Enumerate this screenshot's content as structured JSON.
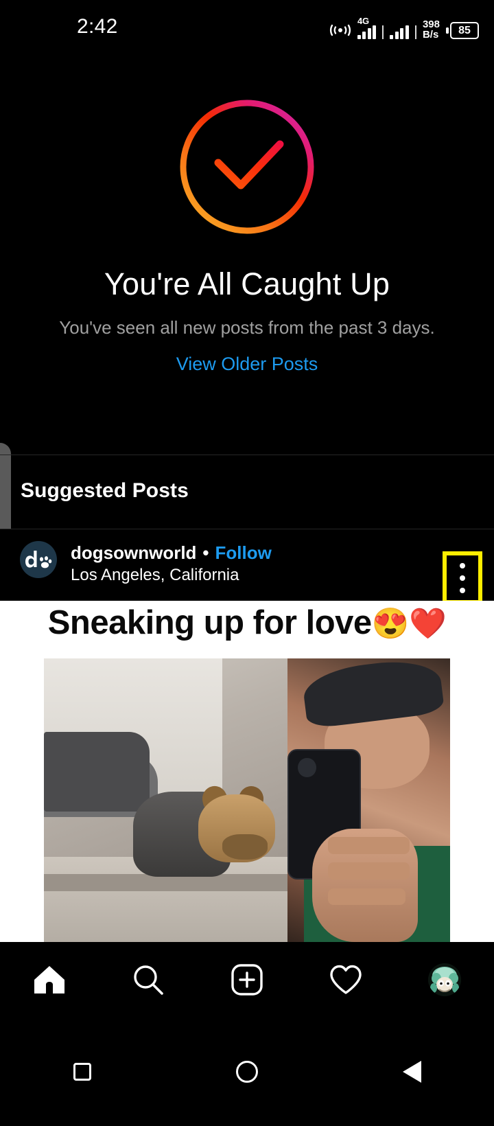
{
  "status_bar": {
    "time": "2:42",
    "network_type": "4G",
    "data_rate_value": "398",
    "data_rate_unit": "B/s",
    "battery_percent": "85",
    "icons": [
      "cast-icon",
      "signal-sim1-icon",
      "signal-sim2-icon",
      "battery-icon"
    ]
  },
  "caught_up": {
    "icon": "check-circle-icon",
    "title": "You're All Caught Up",
    "subtitle": "You've seen all new posts from the past 3 days.",
    "link_label": "View Older Posts",
    "link_color": "#1d9bf0",
    "gradient_start": "#f9a825",
    "gradient_mid": "#f42b03",
    "gradient_end": "#d6249f"
  },
  "suggested": {
    "section_title": "Suggested Posts"
  },
  "post": {
    "avatar_initial": "d",
    "avatar_icon": "paw-print-icon",
    "avatar_bg": "#1e3749",
    "username": "dogsownworld",
    "separator": "•",
    "follow_label": "Follow",
    "follow_color": "#1d9bf0",
    "location": "Los Angeles, California",
    "menu_icon": "more-options-icon",
    "menu_highlight_color": "#ffee00",
    "caption": "Sneaking up for love",
    "caption_emojis": "😍❤️",
    "media_type": "video"
  },
  "bottom_nav": {
    "items": [
      {
        "name": "home",
        "icon": "home-icon",
        "active": true
      },
      {
        "name": "search",
        "icon": "search-icon",
        "active": false
      },
      {
        "name": "create",
        "icon": "plus-square-icon",
        "active": false
      },
      {
        "name": "activity",
        "icon": "heart-icon",
        "active": false
      },
      {
        "name": "profile",
        "icon": "profile-avatar-icon",
        "active": false
      }
    ]
  },
  "system_nav": {
    "items": [
      {
        "name": "recents",
        "icon": "square-icon"
      },
      {
        "name": "home",
        "icon": "circle-icon"
      },
      {
        "name": "back",
        "icon": "triangle-back-icon"
      }
    ]
  }
}
